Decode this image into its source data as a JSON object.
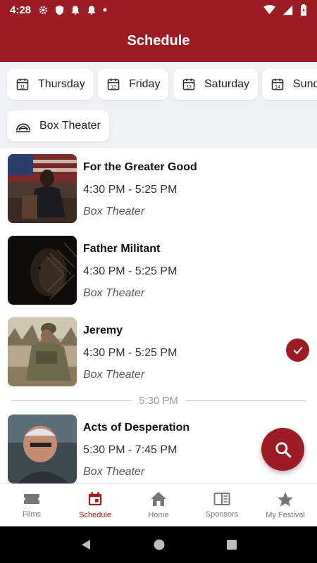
{
  "status_bar": {
    "time": "4:28"
  },
  "app_bar": {
    "title": "Schedule"
  },
  "day_filters": [
    {
      "label": "Thursday",
      "day_number": "11"
    },
    {
      "label": "Friday",
      "day_number": "12"
    },
    {
      "label": "Saturday",
      "day_number": "13"
    },
    {
      "label": "Sunday",
      "day_number": "14"
    }
  ],
  "venue_filter": {
    "label": "Box Theater"
  },
  "films": [
    {
      "name": "For the Greater Good",
      "time": "4:30 PM - 5:25 PM",
      "venue": "Box Theater",
      "in_my_festival": false
    },
    {
      "name": "Father Militant",
      "time": "4:30 PM - 5:25 PM",
      "venue": "Box Theater",
      "in_my_festival": false
    },
    {
      "name": "Jeremy",
      "time": "4:30 PM - 5:25 PM",
      "venue": "Box Theater",
      "in_my_festival": true
    },
    {
      "name": "Acts of Desperation",
      "time": "5:30 PM - 7:45 PM",
      "venue": "Box Theater",
      "in_my_festival": false
    }
  ],
  "time_divider": "5:30 PM",
  "bottom_nav": [
    {
      "label": "Films",
      "icon": "ticket-icon",
      "active": false
    },
    {
      "label": "Schedule",
      "icon": "calendar-icon",
      "active": true
    },
    {
      "label": "Home",
      "icon": "home-icon",
      "active": false
    },
    {
      "label": "Sponsors",
      "icon": "book-icon",
      "active": false
    },
    {
      "label": "My Festival",
      "icon": "star-icon",
      "active": false
    }
  ],
  "colors": {
    "primary": "#9b1c22",
    "filter_bg": "#f0f1f4",
    "text": "#111111",
    "muted": "#777777"
  }
}
